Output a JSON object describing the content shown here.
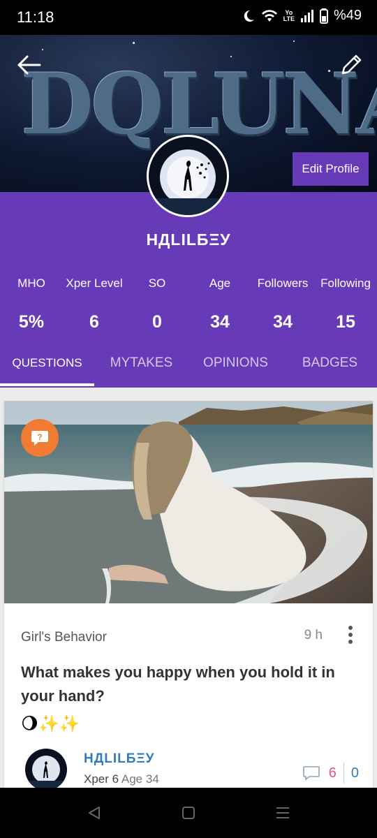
{
  "status_bar": {
    "time": "11:18",
    "network_top": "Yo",
    "network_bottom": "LTE",
    "battery": "%49"
  },
  "profile": {
    "cover_logo_text": "DQLUNAY",
    "edit_profile_label": "Edit Profile",
    "username": "НДLILБΞУ",
    "stats": [
      {
        "label": "MHO",
        "value": "5%"
      },
      {
        "label": "Xper Level",
        "value": "6"
      },
      {
        "label": "SO",
        "value": "0"
      },
      {
        "label": "Age",
        "value": "34"
      },
      {
        "label": "Followers",
        "value": "34"
      },
      {
        "label": "Following",
        "value": "15"
      }
    ],
    "tabs": [
      "QUESTIONS",
      "MYTAKES",
      "OPINIONS",
      "BADGES"
    ],
    "active_tab": "QUESTIONS"
  },
  "post": {
    "category": "Girl's Behavior",
    "time_ago": "9 h",
    "title": "What makes you happy when you hold it in your hand?",
    "emoji": "🌖✨✨",
    "author_name": "НДLILБΞУ",
    "author_level": "Xper 6",
    "author_age": "Age 34",
    "comments_count": "6",
    "votes_count": "0"
  },
  "colors": {
    "brand_purple": "#673ab7",
    "question_badge": "#f27b33",
    "link_blue": "#2f7bbf",
    "comment_pink": "#e0567d"
  },
  "icons": {
    "back": "arrow-left-icon",
    "edit": "pencil-icon",
    "question_badge": "question-bubble-icon",
    "more": "more-vertical-icon",
    "comment": "comment-bubble-icon",
    "nav_back": "triangle-back-icon",
    "nav_home": "square-home-icon",
    "nav_menu": "menu-lines-icon"
  }
}
